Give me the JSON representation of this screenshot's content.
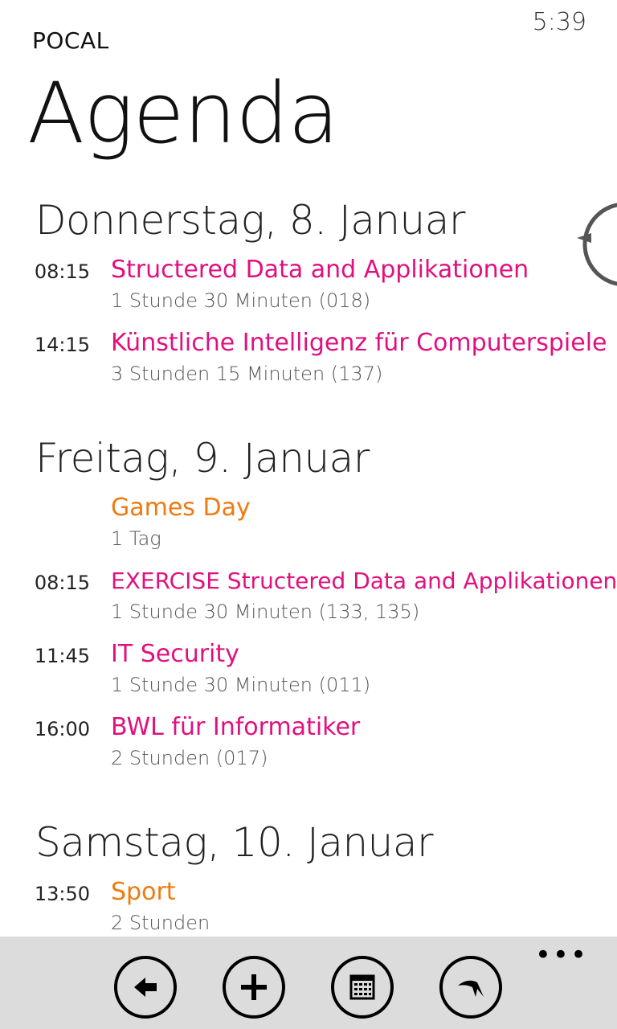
{
  "status_bar": {
    "time": "5:39"
  },
  "app": {
    "name": "POCAL",
    "title": "Agenda"
  },
  "colors": {
    "course": "#e0107f",
    "allday_personal": "#f07a10"
  },
  "days": [
    {
      "header": "Donnerstag, 8. Januar",
      "events": [
        {
          "time": "08:15",
          "title": "Structered Data and Applikationen",
          "detail": "1 Stunde 30 Minuten (018)",
          "color": "pink"
        },
        {
          "time": "14:15",
          "title": "Künstliche Intelligenz für Computerspiele",
          "detail": "3 Stunden 15 Minuten (137)",
          "color": "pink"
        }
      ]
    },
    {
      "header": "Freitag, 9. Januar",
      "events": [
        {
          "time": "",
          "title": "Games Day",
          "detail": "1 Tag",
          "color": "orange"
        },
        {
          "time": "08:15",
          "title": "EXERCISE Structered Data and Applikationen",
          "detail": "1 Stunde 30 Minuten (133, 135)",
          "color": "pink"
        },
        {
          "time": "11:45",
          "title": "IT Security",
          "detail": "1 Stunde 30 Minuten (011)",
          "color": "pink"
        },
        {
          "time": "16:00",
          "title": "BWL für Informatiker",
          "detail": "2 Stunden  (017)",
          "color": "pink"
        }
      ]
    },
    {
      "header": "Samstag, 10. Januar",
      "events": [
        {
          "time": "13:50",
          "title": "Sport",
          "detail": "2 Stunden",
          "color": "orange"
        }
      ]
    }
  ],
  "app_bar": {
    "buttons": [
      "back-arrow-icon",
      "add-icon",
      "calendar-grid-icon",
      "swallow-icon"
    ],
    "more_label": "•••"
  }
}
